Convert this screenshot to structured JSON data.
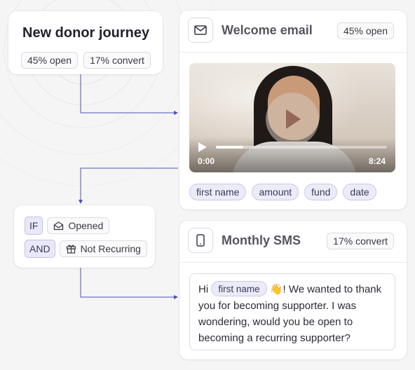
{
  "journey": {
    "title": "New donor journey",
    "open_stat": "45% open",
    "convert_stat": "17% convert"
  },
  "email_step": {
    "icon": "mail-icon",
    "title": "Welcome email",
    "badge": "45% open",
    "video": {
      "current_time": "0:00",
      "duration": "8:24",
      "progress": 0.16
    },
    "tags": [
      "first name",
      "amount",
      "fund",
      "date"
    ]
  },
  "condition": {
    "if_label": "IF",
    "and_label": "AND",
    "rule1_icon": "envelope-open-icon",
    "rule1": "Opened",
    "rule2_icon": "gift-icon",
    "rule2": "Not Recurring"
  },
  "sms_step": {
    "icon": "phone-icon",
    "title": "Monthly SMS",
    "badge": "17% convert",
    "message": {
      "greeting": "Hi",
      "tag": "first name",
      "emoji": "👋",
      "body": "! We wanted to thank you for becoming supporter. I was wondering, would you be open to becoming a recurring supporter?"
    }
  },
  "colors": {
    "connector": "#4a52b8",
    "tag_bg": "#ecebf8",
    "tag_border": "#c9c7e6"
  }
}
